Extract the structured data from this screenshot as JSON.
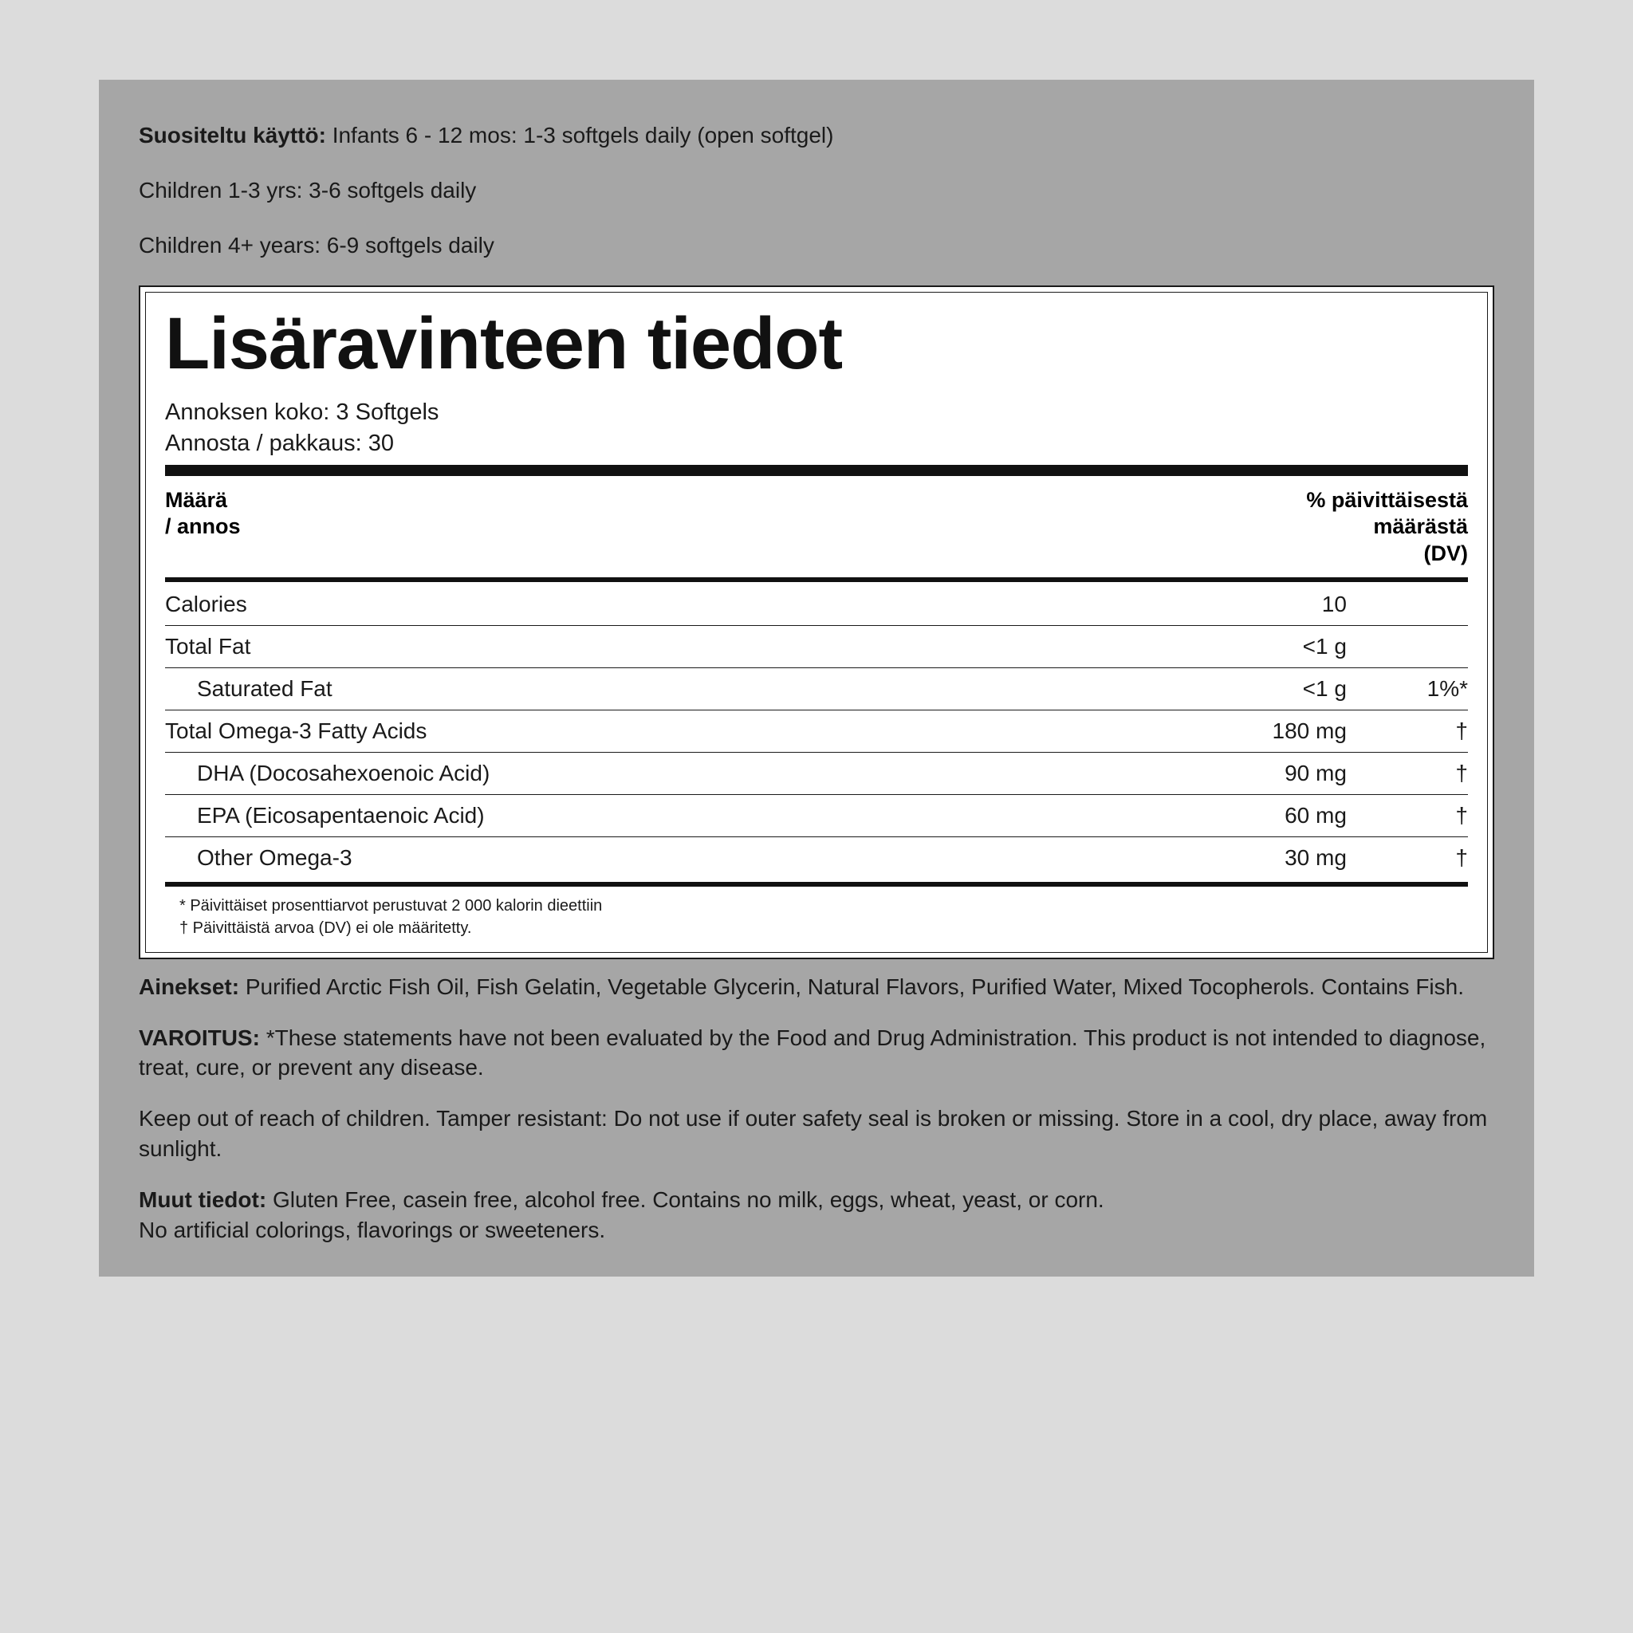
{
  "usage": {
    "label": "Suositeltu käyttö:",
    "line1": "Infants 6 - 12 mos: 1-3 softgels daily (open softgel)",
    "line2": "Children 1-3 yrs: 3-6 softgels daily",
    "line3": "Children 4+ years: 6-9 softgels daily"
  },
  "facts": {
    "title": "Lisäravinteen tiedot",
    "serving_size_label": "Annoksen koko:",
    "serving_size_value": "3 Softgels",
    "servings_label": "Annosta / pakkaus:",
    "servings_value": "30",
    "header_amount_l1": "Määrä",
    "header_amount_l2": "/ annos",
    "header_dv_l1": "% päivittäisestä",
    "header_dv_l2": "määrästä",
    "header_dv_l3": "(DV)",
    "rows": [
      {
        "name": "Calories",
        "amount": "10",
        "dv": "",
        "indent": false
      },
      {
        "name": "Total Fat",
        "amount": "<1 g",
        "dv": "",
        "indent": false
      },
      {
        "name": "Saturated Fat",
        "amount": "<1 g",
        "dv": "1%*",
        "indent": true
      },
      {
        "name": "Total Omega-3 Fatty Acids",
        "amount": "180 mg",
        "dv": "†",
        "indent": false
      },
      {
        "name": "DHA (Docosahexoenoic Acid)",
        "amount": "90 mg",
        "dv": "†",
        "indent": true
      },
      {
        "name": "EPA (Eicosapentaenoic Acid)",
        "amount": "60 mg",
        "dv": "†",
        "indent": true
      },
      {
        "name": "Other Omega-3",
        "amount": "30 mg",
        "dv": "†",
        "indent": true
      }
    ],
    "footnote1": "* Päivittäiset prosenttiarvot perustuvat 2 000 kalorin dieettiin",
    "footnote2": "† Päivittäistä arvoa (DV) ei ole määritetty."
  },
  "ingredients": {
    "label": "Ainekset:",
    "text": "Purified Arctic Fish Oil, Fish Gelatin, Vegetable Glycerin, Natural Flavors, Purified Water, Mixed Tocopherols. Contains Fish."
  },
  "warning": {
    "label": "VAROITUS:",
    "text": "*These statements have not been evaluated by the Food and Drug Administration. This product is not intended to diagnose, treat, cure, or prevent any disease."
  },
  "storage": {
    "text": "Keep out of reach of children. Tamper resistant: Do not use if outer safety seal is broken or missing. Store in a cool, dry place, away from sunlight."
  },
  "other": {
    "label": "Muut tiedot:",
    "text1": "Gluten Free, casein free, alcohol free. Contains no milk, eggs, wheat, yeast, or corn.",
    "text2": "No artificial colorings, flavorings or sweeteners."
  }
}
